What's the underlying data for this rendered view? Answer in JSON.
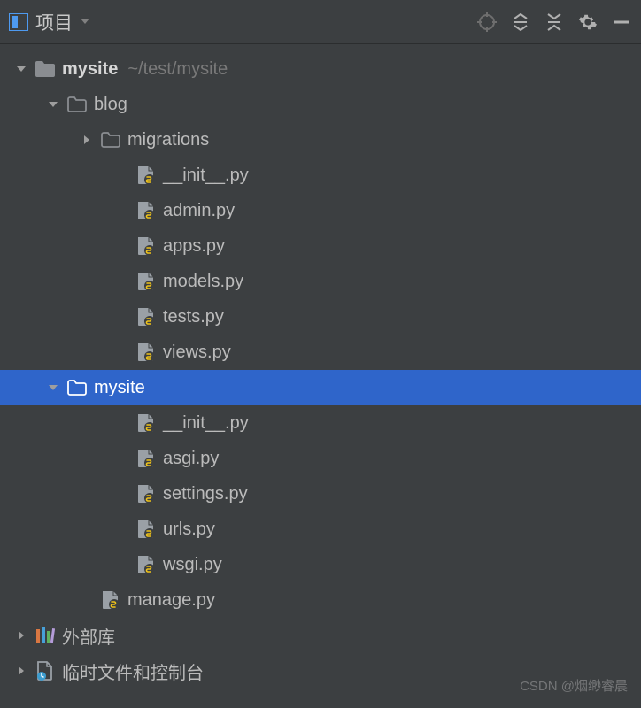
{
  "toolbar": {
    "project_label": "项目"
  },
  "tree": [
    {
      "indent": 0,
      "chevron": "down",
      "icon": "folder-solid",
      "label": "mysite",
      "bold": true,
      "suffix": "~/test/mysite",
      "selected": false
    },
    {
      "indent": 1,
      "chevron": "down",
      "icon": "folder",
      "label": "blog",
      "bold": false,
      "selected": false
    },
    {
      "indent": 2,
      "chevron": "right",
      "icon": "folder",
      "label": "migrations",
      "bold": false,
      "selected": false
    },
    {
      "indent": 3,
      "chevron": "none",
      "icon": "pyfile",
      "label": "__init__.py",
      "bold": false,
      "selected": false
    },
    {
      "indent": 3,
      "chevron": "none",
      "icon": "pyfile",
      "label": "admin.py",
      "bold": false,
      "selected": false
    },
    {
      "indent": 3,
      "chevron": "none",
      "icon": "pyfile",
      "label": "apps.py",
      "bold": false,
      "selected": false
    },
    {
      "indent": 3,
      "chevron": "none",
      "icon": "pyfile",
      "label": "models.py",
      "bold": false,
      "selected": false
    },
    {
      "indent": 3,
      "chevron": "none",
      "icon": "pyfile",
      "label": "tests.py",
      "bold": false,
      "selected": false
    },
    {
      "indent": 3,
      "chevron": "none",
      "icon": "pyfile",
      "label": "views.py",
      "bold": false,
      "selected": false
    },
    {
      "indent": 1,
      "chevron": "down",
      "icon": "folder",
      "label": "mysite",
      "bold": false,
      "selected": true
    },
    {
      "indent": 3,
      "chevron": "none",
      "icon": "pyfile",
      "label": "__init__.py",
      "bold": false,
      "selected": false
    },
    {
      "indent": 3,
      "chevron": "none",
      "icon": "pyfile",
      "label": "asgi.py",
      "bold": false,
      "selected": false
    },
    {
      "indent": 3,
      "chevron": "none",
      "icon": "pyfile",
      "label": "settings.py",
      "bold": false,
      "selected": false
    },
    {
      "indent": 3,
      "chevron": "none",
      "icon": "pyfile",
      "label": "urls.py",
      "bold": false,
      "selected": false
    },
    {
      "indent": 3,
      "chevron": "none",
      "icon": "pyfile",
      "label": "wsgi.py",
      "bold": false,
      "selected": false
    },
    {
      "indent": 2,
      "chevron": "none",
      "icon": "pyfile",
      "label": "manage.py",
      "bold": false,
      "selected": false
    },
    {
      "indent": 0,
      "chevron": "right",
      "icon": "libs",
      "label": "外部库",
      "bold": false,
      "selected": false
    },
    {
      "indent": 0,
      "chevron": "right",
      "icon": "scratch",
      "label": "临时文件和控制台",
      "bold": false,
      "selected": false
    }
  ],
  "watermark": "CSDN @烟缈睿晨"
}
